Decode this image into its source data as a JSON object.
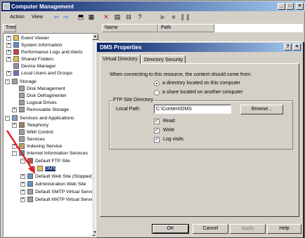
{
  "main_window": {
    "title": "Computer Management",
    "title_buttons": [
      "_",
      "□",
      "×"
    ]
  },
  "menu": {
    "action": "Action",
    "view": "View"
  },
  "toolbar_icons": [
    "back-icon",
    "forward-icon",
    "up-icon",
    "show-hide-icon",
    "delete-icon",
    "properties-icon",
    "help-icon",
    "play-icon",
    "stop-icon",
    "pause-icon"
  ],
  "tree": {
    "header": "Tree",
    "items": [
      {
        "label": "Event Viewer"
      },
      {
        "label": "System Information"
      },
      {
        "label": "Performance Logs and Alerts"
      },
      {
        "label": "Shared Folders"
      },
      {
        "label": "Device Manager"
      },
      {
        "label": "Local Users and Groups"
      },
      {
        "label": "Storage"
      },
      {
        "label": "Disk Management"
      },
      {
        "label": "Disk Defragmenter"
      },
      {
        "label": "Logical Drives"
      },
      {
        "label": "Removable Storage"
      },
      {
        "label": "Services and Applications"
      },
      {
        "label": "Telephony"
      },
      {
        "label": "WMI Control"
      },
      {
        "label": "Services"
      },
      {
        "label": "Indexing Service"
      },
      {
        "label": "Internet Information Services"
      },
      {
        "label": "Default FTP Site"
      },
      {
        "label": "DMS"
      },
      {
        "label": "Default Web Site (Stopped)"
      },
      {
        "label": "Administration Web Site"
      },
      {
        "label": "Default SMTP Virtual Server"
      },
      {
        "label": "Default NNTP Virtual Server"
      }
    ]
  },
  "list": {
    "columns": [
      "Name",
      "Path"
    ]
  },
  "dialog": {
    "title": "DMS Properties",
    "title_buttons": [
      "?",
      "×"
    ],
    "tabs": [
      "Virtual Directory",
      "Directory Security"
    ],
    "connect_prompt": "When connecting to this resource, the content should come from:",
    "radio_local": "a directory located on this computer",
    "radio_share": "a share located on another computer",
    "group_title": "FTP Site Directory",
    "local_path_label": "Local Path:",
    "local_path_value": "C:\\Content\\DMS",
    "browse_button": "Browse...",
    "check_read": "Read",
    "check_write": "Write",
    "check_log": "Log visits",
    "buttons": {
      "ok": "OK",
      "cancel": "Cancel",
      "apply": "Apply",
      "help": "Help"
    }
  },
  "colors": {
    "title_bar": "#0a246a",
    "arrow": "#e02020"
  }
}
